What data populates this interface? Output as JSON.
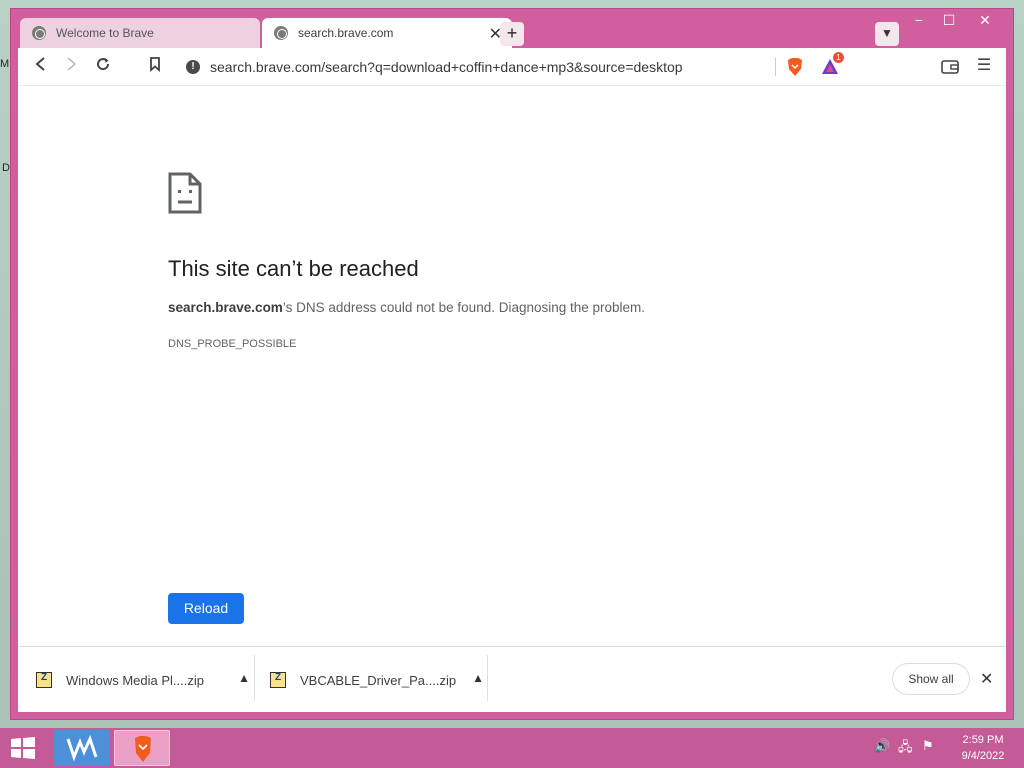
{
  "window": {
    "tabs": [
      {
        "label": "Welcome to Brave",
        "active": false
      },
      {
        "label": "search.brave.com",
        "active": true
      }
    ],
    "new_tab_label": "+",
    "controls": {
      "minimize": "−",
      "maximize": "☐",
      "close": "✕"
    }
  },
  "toolbar": {
    "url": "search.brave.com/search?q=download+coffin+dance+mp3&source=desktop",
    "rewards_badge": "1"
  },
  "error_page": {
    "title": "This site can’t be reached",
    "host": "search.brave.com",
    "description_suffix": "’s DNS address could not be found. Diagnosing the problem.",
    "code": "DNS_PROBE_POSSIBLE",
    "reload_label": "Reload"
  },
  "downloads": {
    "items": [
      {
        "name": "Windows Media Pl....zip"
      },
      {
        "name": "VBCABLE_Driver_Pa....zip"
      }
    ],
    "show_all_label": "Show all"
  },
  "taskbar": {
    "time": "2:59 PM",
    "date": "9/4/2022"
  },
  "colors": {
    "window_frame": "#d25f9d",
    "taskbar": "#c55b96",
    "reload_button": "#1a73e8",
    "desktop": "#b6d2c2"
  }
}
